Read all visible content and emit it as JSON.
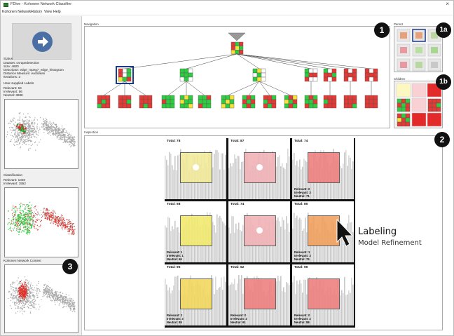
{
  "window": {
    "title": "FDive - Kohonen Network Classifier",
    "close_glyph": "×"
  },
  "menu": [
    "Kohonen Network",
    "History",
    "View",
    "Help"
  ],
  "left": {
    "status_header": "Status",
    "status_lines": [
      "Dataset: ovrapedetection",
      "Size: 4600",
      "Descriptor: edge_mpeg7_edge_histogram",
      "Distance Measure: euclidean",
      "Iterations: 3"
    ],
    "labels_header": "User-supplied Labels",
    "labels_lines": [
      "Relevant: 64",
      "Irrelevant: 56",
      "Neutral: 3888"
    ],
    "classification_header": "Classification",
    "classification_lines": [
      "Relevant: 1048",
      "Irrelevant: 1552"
    ],
    "context_header": "Kohonen Network Context"
  },
  "panels": {
    "navigation": "Navigation",
    "parent": "Parent",
    "children": "Children",
    "inspection": "Inspection"
  },
  "callouts": {
    "nav": "1",
    "parent": "1a",
    "children": "1b",
    "inspection": "2",
    "context": "3"
  },
  "inspection_cells": [
    {
      "total": "Total: 78",
      "color": "#f2ea9a",
      "dot": true,
      "counts": null
    },
    {
      "total": "Total: 87",
      "color": "#f2b3b8",
      "dot": true,
      "counts": null
    },
    {
      "total": "Total: 74",
      "color": "#ee8080",
      "dot": false,
      "counts": [
        "Relevant: 0",
        "Irrelevant: 3",
        "Neutral: 71"
      ]
    },
    {
      "total": "Total: 68",
      "color": "#f2ea70",
      "dot": false,
      "counts": [
        "Relevant: 1",
        "Irrelevant: 1",
        "Neutral: 66"
      ]
    },
    {
      "total": "Total: 74",
      "color": "#f2b3b8",
      "dot": true,
      "counts": null
    },
    {
      "total": "Total: 80",
      "color": "#f2a15f",
      "dot": false,
      "counts": [
        "Relevant: 1",
        "Irrelevant: 3",
        "Neutral: 76"
      ]
    },
    {
      "total": "Total: 95",
      "color": "#f2d85f",
      "dot": false,
      "counts": [
        "Relevant: 2",
        "Irrelevant: 3",
        "Neutral: 89"
      ]
    },
    {
      "total": "Total: 62",
      "color": "#ee8080",
      "dot": false,
      "counts": [
        "Relevant: 0",
        "Irrelevant: 2",
        "Neutral: 61"
      ]
    },
    {
      "total": "Total: 90",
      "color": "#ee8080",
      "dot": false,
      "counts": [
        "Relevant: 0",
        "Irrelevant: 2",
        "Neutral: 88"
      ]
    }
  ],
  "annotation": {
    "title": "Labeling",
    "subtitle": "Model Refinement"
  },
  "colors": {
    "relevant": "#2ecc40",
    "irrelevant": "#e53935",
    "neutral": "#f5e33a",
    "selected": "#1a3a8a"
  }
}
